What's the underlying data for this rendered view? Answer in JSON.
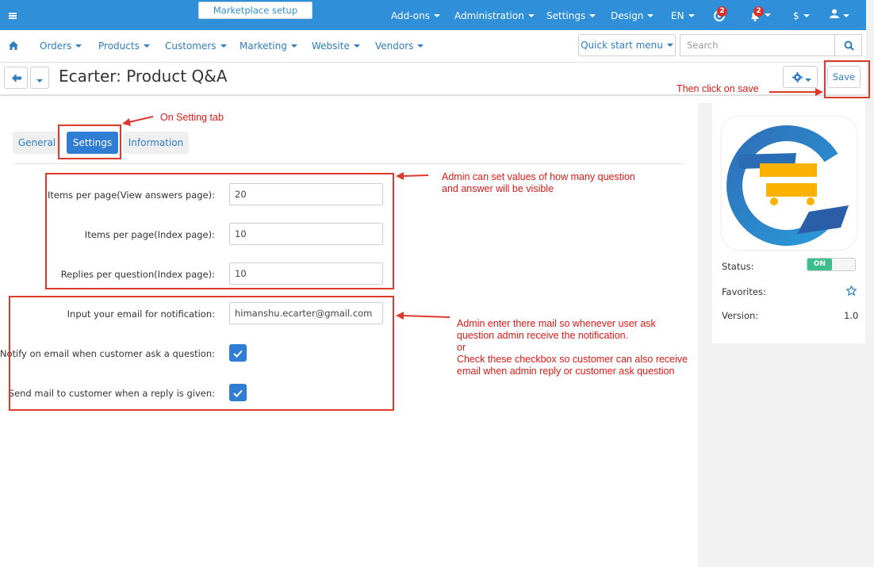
{
  "topbar": {
    "wizard_label": "Marketplace setup wizard",
    "menu": [
      "Add-ons",
      "Administration",
      "Settings",
      "Design",
      "EN"
    ],
    "help_badge": "2",
    "notif_badge": "2",
    "currency": "$"
  },
  "nav": {
    "items": [
      "Orders",
      "Products",
      "Customers",
      "Marketing",
      "Website",
      "Vendors"
    ],
    "quick_start": "Quick start menu",
    "search_placeholder": "Search"
  },
  "title": {
    "text": "Ecarter: Product Q&A",
    "save_label": "Save"
  },
  "tabs": [
    "General",
    "Settings",
    "Information"
  ],
  "form": {
    "fields": [
      {
        "label": "Items per page(View answers page):",
        "value": "20"
      },
      {
        "label": "Items per page(Index page):",
        "value": "10"
      },
      {
        "label": "Replies per question(Index page):",
        "value": "10"
      },
      {
        "label": "Input your email for notification:",
        "value": "himanshu.ecarter@gmail.com"
      }
    ],
    "checkboxes": [
      {
        "label": "Notify on email when customer ask a question:",
        "checked": true
      },
      {
        "label": "Send mail to customer when a reply is given:",
        "checked": true
      }
    ]
  },
  "sidebar": {
    "status_label": "Status:",
    "status_value": "ON",
    "favorites_label": "Favorites:",
    "version_label": "Version:",
    "version_value": "1.0"
  },
  "annotations": {
    "save": "Then click on save",
    "tab": "On Setting tab",
    "admin_values": [
      "Admin can set values of how many question",
      "and answer will be visible"
    ],
    "email": [
      "Admin enter there mail so whenever user ask",
      "question admin receive the notification.",
      "or",
      "Check these checkbox so customer can also receive",
      "email when admin reply or customer ask question"
    ]
  },
  "colors": {
    "topbar": "#2f8fd8",
    "link": "#2e7dc3",
    "annotation": "#dd3a2e",
    "toggle_on": "#3ebd8d"
  }
}
